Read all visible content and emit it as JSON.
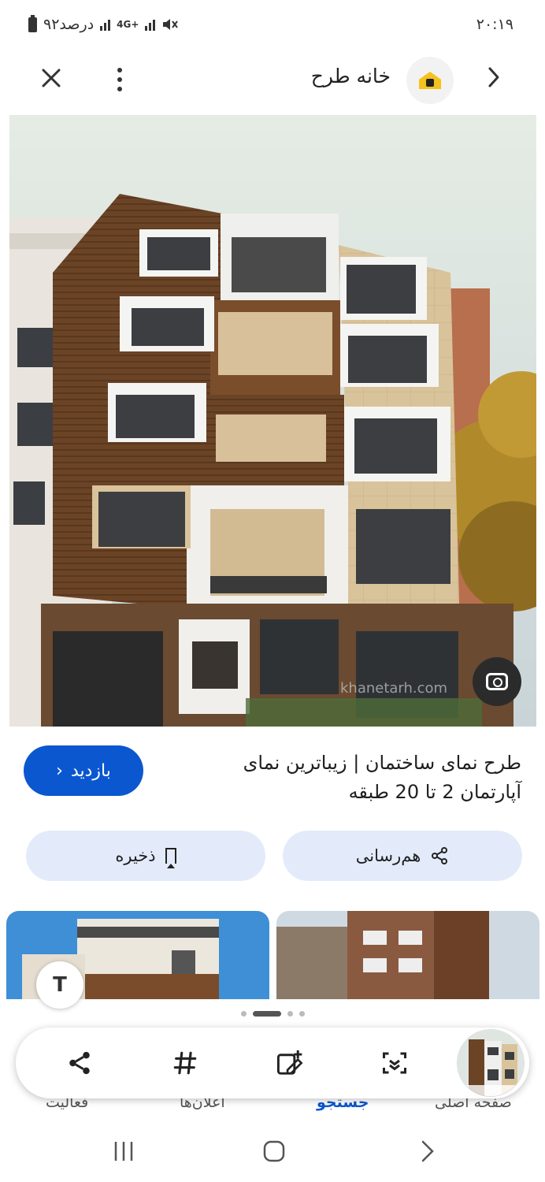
{
  "status_bar": {
    "time": "۲۰:۱۹",
    "battery_text": "۹۲درصد",
    "network": "4G+"
  },
  "app_bar": {
    "site_name": "خانه طرح"
  },
  "result": {
    "title": "طرح نمای ساختمان | زیباترین نمای آپارتمان 2 تا 20 طبقه",
    "watermark": "khanetarh.com",
    "visit_label": "بازدید",
    "share_label": "هم‌رسانی",
    "save_label": "ذخیره"
  },
  "bottom_nav": {
    "items": [
      {
        "label": "فعالیت",
        "icon": "share-icon"
      },
      {
        "label": "اعلان‌ها",
        "icon": "hashtag-icon"
      },
      {
        "label": "جستجو",
        "icon": "add-note-icon"
      },
      {
        "label": "صفحه اصلی",
        "icon": "scan-icon"
      }
    ],
    "active_index": 2
  },
  "pagination": {
    "count": 4,
    "active": 1
  },
  "colors": {
    "accent": "#0b57d0",
    "tonal_button": "#e3ebfb",
    "wood": "#6b4426",
    "stone": "#d9c39a",
    "white_frame": "#f1f1ef"
  }
}
